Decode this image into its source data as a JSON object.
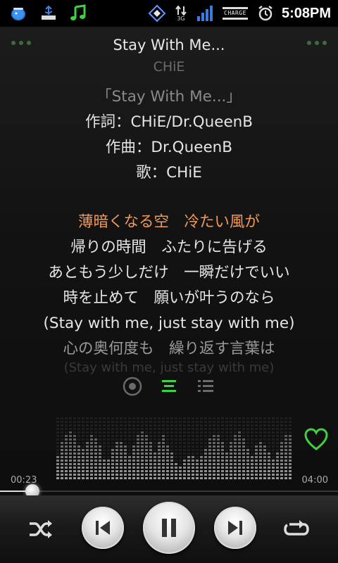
{
  "status_bar": {
    "time": "5:08PM",
    "network": "3G",
    "charge_label": "CHARGE",
    "icons": [
      "fish-app-icon",
      "usb-icon",
      "music-note-icon",
      "sync-icon",
      "data-arrows-icon",
      "signal-bars-icon",
      "battery-charging-icon",
      "alarm-clock-icon"
    ]
  },
  "song": {
    "title": "Stay With Me...",
    "artist": "CHiE"
  },
  "lyrics": {
    "header": [
      "「Stay With Me...」",
      "作詞：CHiE/Dr.QueenB",
      "作曲：Dr.QueenB",
      "歌：CHiE"
    ],
    "lines": [
      "薄暗くなる空　冷たい風が",
      "帰りの時間　ふたりに告げる",
      "あともう少しだけ　一瞬だけでいい",
      "時を止めて　願いが叶うのなら",
      "(Stay with me, just stay with me)",
      "心の奥何度も　繰り返す言葉は",
      "(Stay with me, just stay with me)"
    ],
    "current_index": 0
  },
  "view_modes": [
    "disc-view-icon",
    "lyrics-view-icon",
    "list-view-icon"
  ],
  "playback": {
    "elapsed": "00:23",
    "duration": "04:00",
    "progress": 0.096,
    "favorite": true
  },
  "controls": {
    "shuffle": "shuffle-icon",
    "previous": "previous-track-icon",
    "play_pause": "pause-icon",
    "next": "next-track-icon",
    "repeat": "repeat-icon"
  },
  "colors": {
    "accent": "#3fd13f",
    "current_lyric": "#f09a5a"
  }
}
